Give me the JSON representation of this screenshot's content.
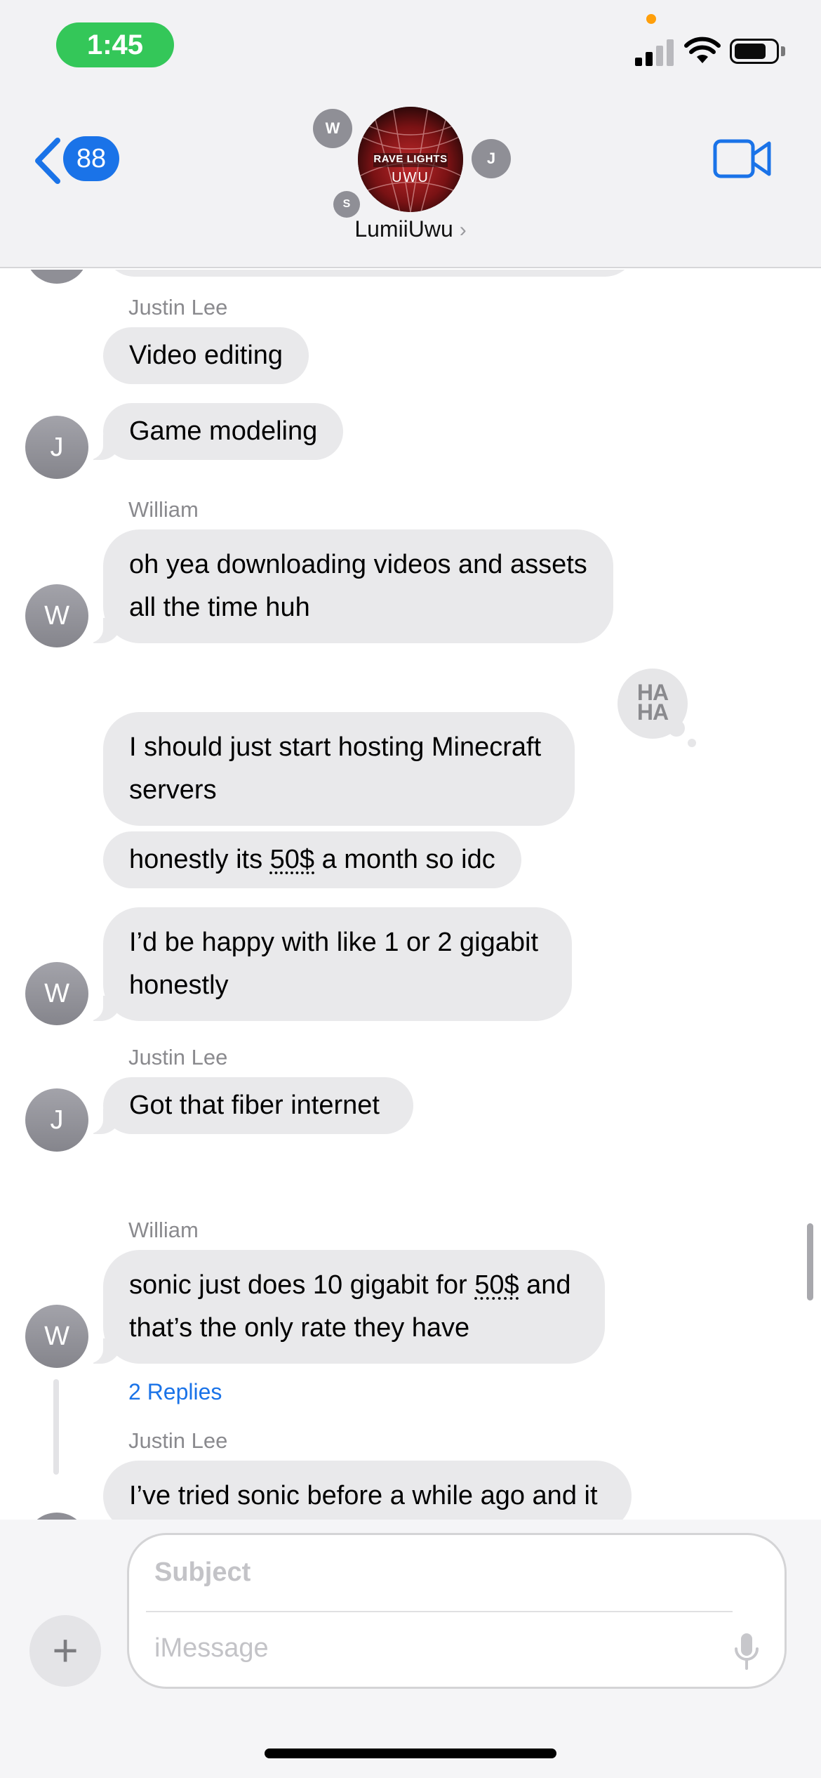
{
  "status": {
    "time": "1:45",
    "colors": {
      "time_pill": "#34c759",
      "recording_dot": "#ff9f0a"
    },
    "icons": [
      "signal-icon",
      "wifi-icon",
      "battery-icon"
    ]
  },
  "header": {
    "back_count": "88",
    "group_name": "LumiiUwu",
    "group_chevron": "›",
    "avatar_text_top": "RAVE LIGHTS",
    "avatar_text_bottom": "UWU",
    "member_initials": [
      "W",
      "J",
      "S"
    ],
    "accent_color": "#1a73e8"
  },
  "messages": {
    "m1_sender": "Justin Lee",
    "m1_b1": "Video editing",
    "m1_b2": "Game modeling",
    "m1_avatar": "J",
    "m2_sender": "William",
    "m2_line1": "oh yea downloading videos and assets",
    "m2_line2": "all the time huh",
    "m2_avatar": "W",
    "tapback_top": "HA",
    "tapback_bottom": "HA",
    "m3_line1": "I should just start hosting Minecraft",
    "m3_line2": "servers",
    "m4_pre": "honestly its ",
    "m4_link": "50$",
    "m4_post": " a month so idc",
    "m5_line1": "I’d be happy with like 1 or 2 gigabit",
    "m5_line2": "honestly",
    "m5_avatar": "W",
    "m6_sender": "Justin Lee",
    "m6_b1": "Got that fiber internet",
    "m6_avatar": "J",
    "m7_sender": "William",
    "m7_line1_pre": "sonic just does 10 gigabit for ",
    "m7_line1_link": "50$",
    "m7_line1_post": " and",
    "m7_line2": "that’s the only rate they have",
    "m7_avatar": "W",
    "m7_replies": "2 Replies",
    "m8_sender": "Justin Lee",
    "m8_line1": "I’ve tried sonic before a while ago and it"
  },
  "compose": {
    "subject_placeholder": "Subject",
    "message_placeholder": "iMessage",
    "plus_label": "+"
  }
}
